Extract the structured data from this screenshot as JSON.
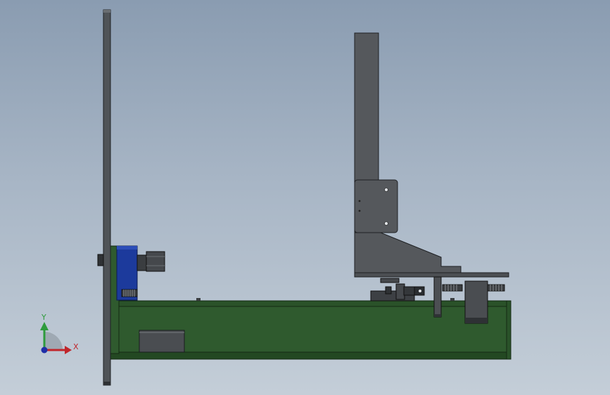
{
  "viewport": {
    "background_top": "#8a9cb1",
    "background_bottom": "#c4ced8"
  },
  "model": {
    "colors": {
      "plate": "#4f5357",
      "plate_edge": "#1e2023",
      "bracket": "#55585c",
      "base": "#2f5a2e",
      "base_dark": "#234822",
      "base_edge": "#142914",
      "block": "#1c3a9c",
      "hardware": "#3a3d40",
      "hardware_light": "#6b6f73"
    }
  },
  "triad": {
    "x_label": "X",
    "y_label": "Y",
    "x_color": "#c0262b",
    "y_color": "#2e9b3c",
    "z_color": "#1f2fa8"
  }
}
